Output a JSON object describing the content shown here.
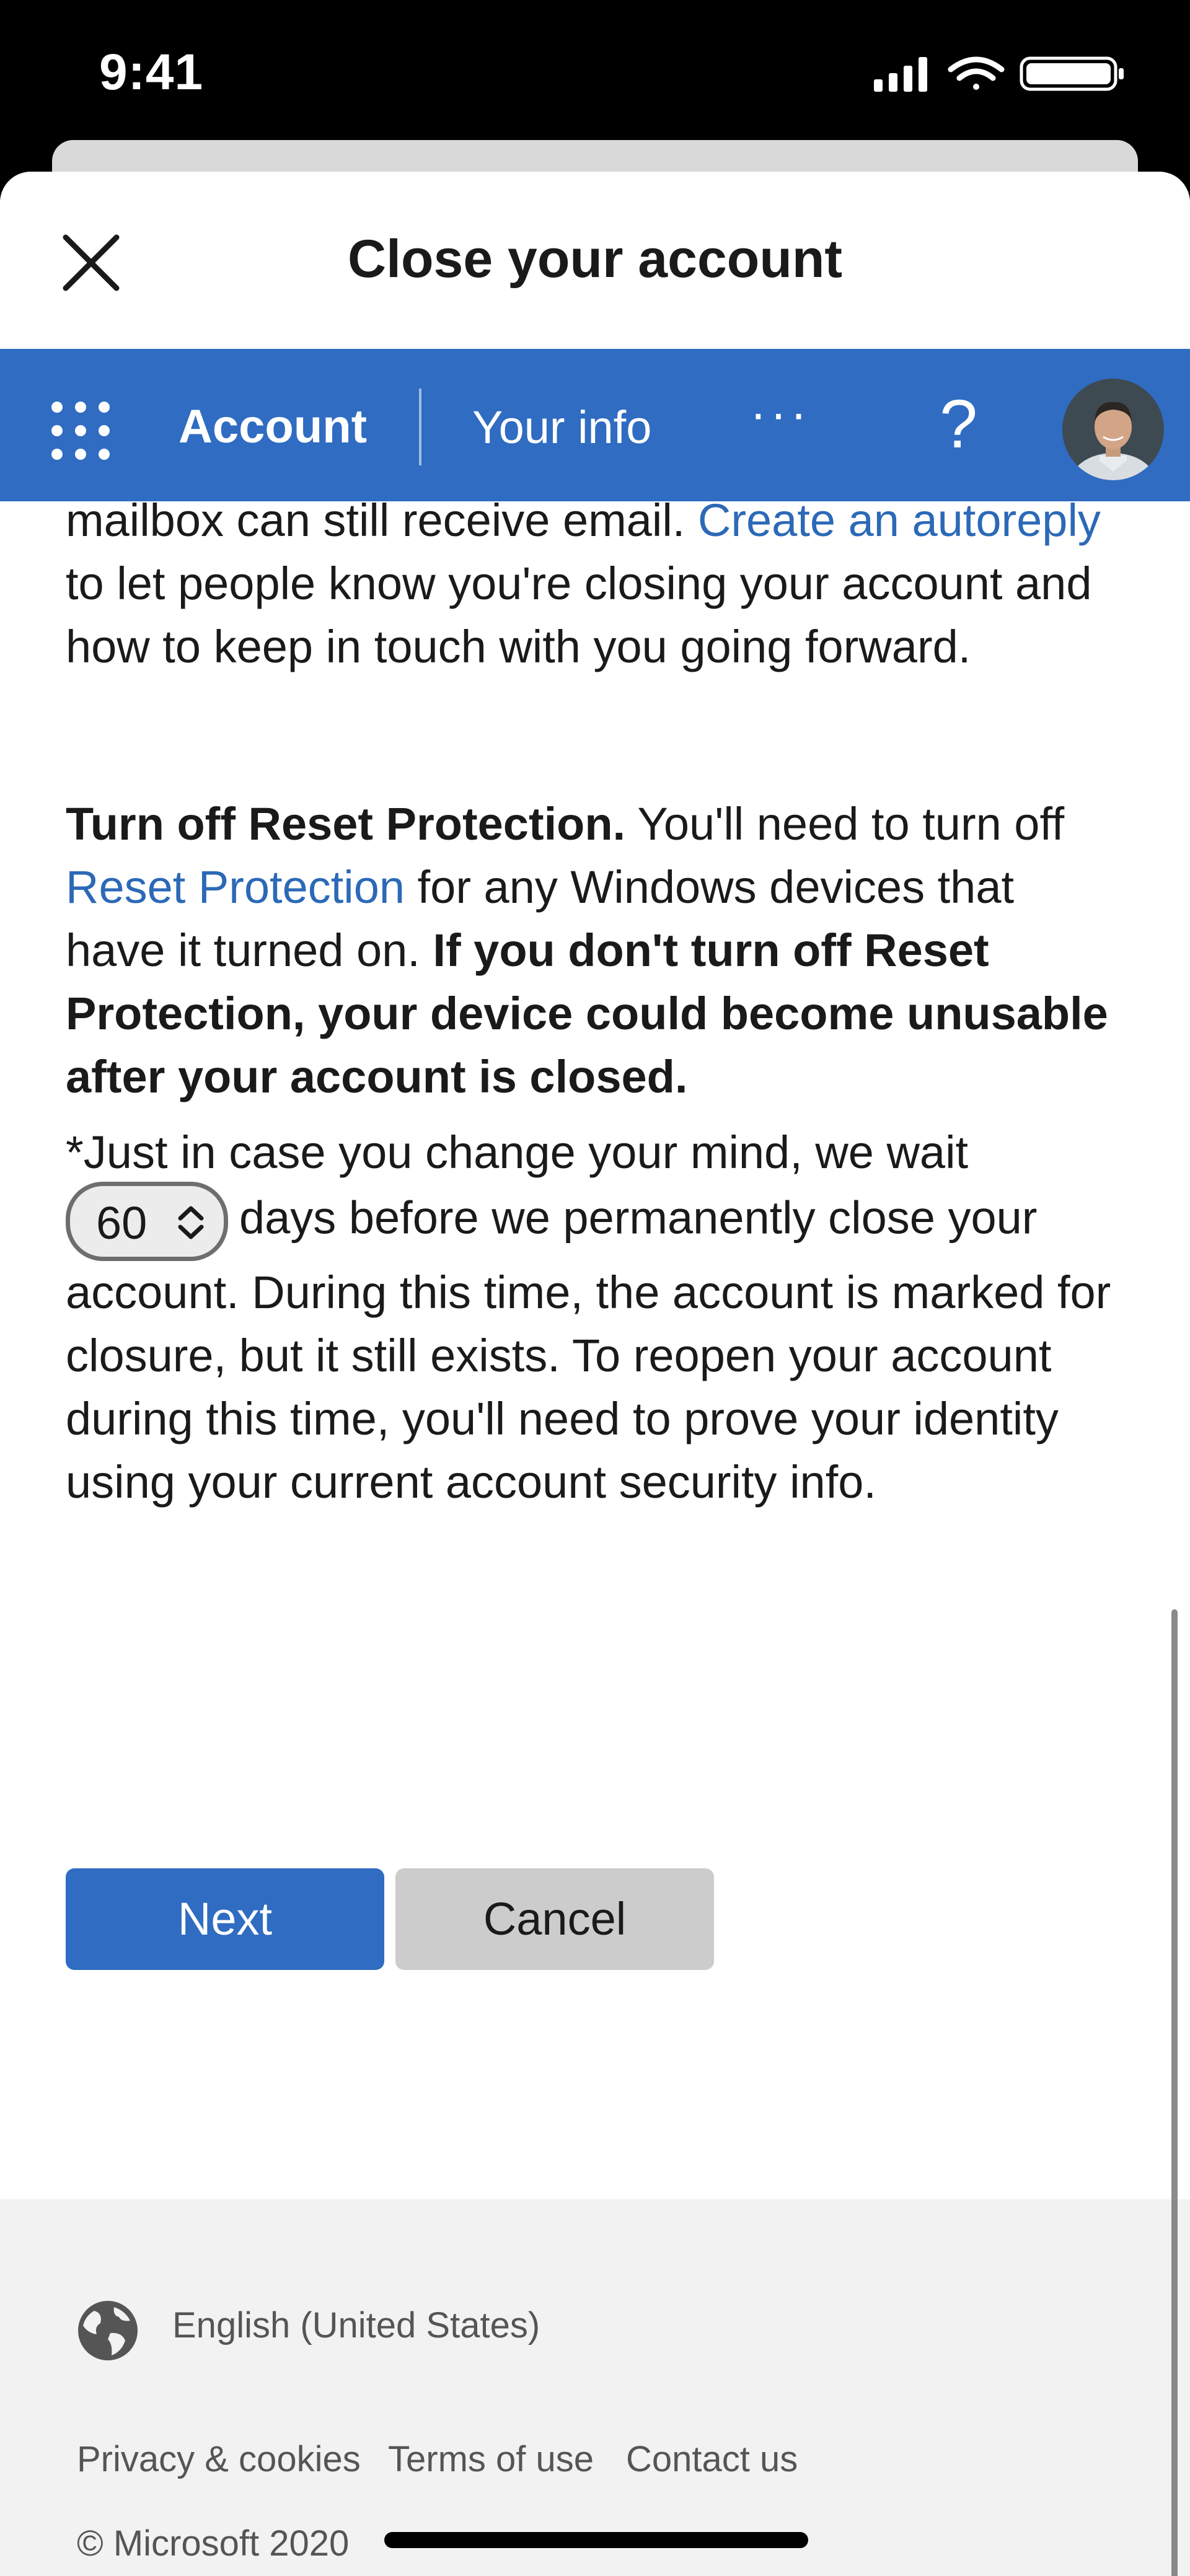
{
  "status_bar": {
    "time": "9:41"
  },
  "sheet": {
    "title": "Close your account"
  },
  "nav": {
    "account_label": "Account",
    "your_info_label": "Your info",
    "more_label": "···",
    "help_label": "?"
  },
  "content": {
    "p1": {
      "text_a": "mailbox can still receive email. ",
      "link": "Create an autoreply",
      "text_b": " to let people know you're closing your account and how to keep in touch with you going forward."
    },
    "p2": {
      "bold_a": "Turn off Reset Protection.",
      "text_a": " You'll need to turn off ",
      "link": "Reset Protection",
      "text_b": " for any Windows devices that have it turned on. ",
      "bold_b": "If you don't turn off Reset Protection, your device could become unusable after your account is closed."
    },
    "p3": {
      "text_a": "*Just in case you change your mind, we wait",
      "days_value": "60",
      "text_b": "days before we permanently close your account. During this time, the account is marked for closure, but it still exists. To reopen your account during this time, you'll need to prove your identity using your current account security info."
    }
  },
  "buttons": {
    "next": "Next",
    "cancel": "Cancel"
  },
  "footer": {
    "language": "English (United States)",
    "links": [
      "Privacy & cookies",
      "Terms of use",
      "Contact us"
    ],
    "copyright": "© Microsoft 2020"
  },
  "colors": {
    "brand_blue": "#2f6cc2",
    "link_blue": "#2c69b7"
  }
}
